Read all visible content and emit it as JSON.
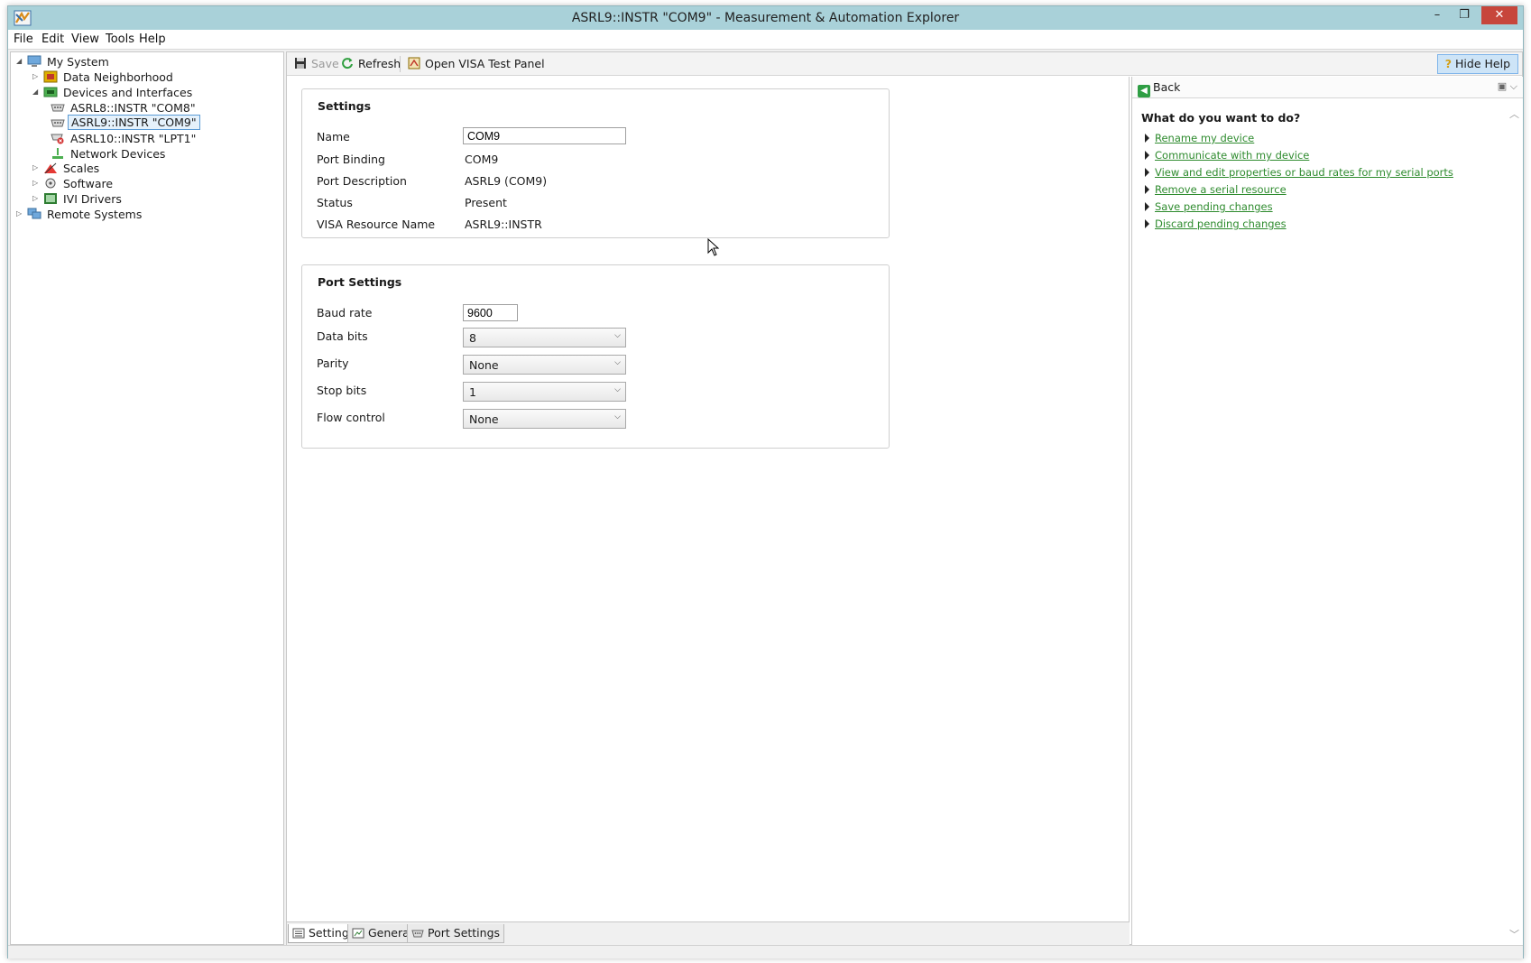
{
  "window": {
    "title": "ASRL9::INSTR \"COM9\" - Measurement & Automation Explorer",
    "controls": {
      "minimize": "–",
      "maximize": "❐",
      "close": "✕"
    }
  },
  "menu": [
    "File",
    "Edit",
    "View",
    "Tools",
    "Help"
  ],
  "tree": {
    "items": [
      {
        "label": "My System",
        "icon": "computer-icon",
        "expanded": true
      },
      {
        "label": "Data Neighborhood",
        "icon": "data-neighborhood-icon",
        "expanded": false
      },
      {
        "label": "Devices and Interfaces",
        "icon": "devices-icon",
        "expanded": true
      },
      {
        "label": "ASRL8::INSTR \"COM8\"",
        "icon": "serial-port-icon"
      },
      {
        "label": "ASRL9::INSTR \"COM9\"",
        "icon": "serial-port-icon",
        "selected": true
      },
      {
        "label": "ASRL10::INSTR \"LPT1\"",
        "icon": "serial-port-error-icon"
      },
      {
        "label": "Network Devices",
        "icon": "network-icon"
      },
      {
        "label": "Scales",
        "icon": "scales-icon",
        "expanded": false
      },
      {
        "label": "Software",
        "icon": "software-icon",
        "expanded": false
      },
      {
        "label": "IVI Drivers",
        "icon": "ivi-icon",
        "expanded": false
      },
      {
        "label": "Remote Systems",
        "icon": "remote-systems-icon",
        "expanded": false
      }
    ]
  },
  "toolbar": {
    "save": "Save",
    "refresh": "Refresh",
    "open_visa": "Open VISA Test Panel",
    "hide_help": "Hide Help"
  },
  "settings": {
    "title": "Settings",
    "name_label": "Name",
    "name_value": "COM9",
    "port_binding_label": "Port Binding",
    "port_binding_value": "COM9",
    "port_description_label": "Port Description",
    "port_description_value": "ASRL9  (COM9)",
    "status_label": "Status",
    "status_value": "Present",
    "visa_label": "VISA Resource Name",
    "visa_value": "ASRL9::INSTR"
  },
  "port_settings": {
    "title": "Port Settings",
    "baud_label": "Baud rate",
    "baud_value": "9600",
    "data_bits_label": "Data bits",
    "data_bits_value": "8",
    "parity_label": "Parity",
    "parity_value": "None",
    "stop_bits_label": "Stop bits",
    "stop_bits_value": "1",
    "flow_label": "Flow control",
    "flow_value": "None"
  },
  "tabs": [
    "Settings",
    "General",
    "Port Settings"
  ],
  "help": {
    "back": "Back",
    "heading": "What do you want to do?",
    "links": [
      "Rename my device",
      "Communicate with my device",
      "View and edit properties or baud rates for my serial ports",
      "Remove a serial resource",
      "Save pending changes",
      "Discard pending changes"
    ]
  },
  "colors": {
    "titlebar": "#a9d1d9",
    "link": "#2e8b2e",
    "close_button": "#c7463b",
    "selection": "#e5f1fb"
  }
}
